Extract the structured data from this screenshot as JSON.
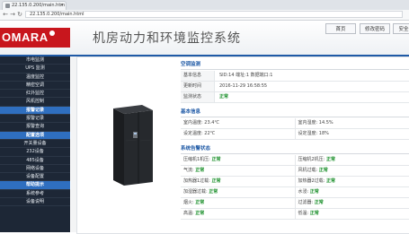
{
  "browser": {
    "tab_title": "22.135.0.200/main.htm",
    "url": "22.135.0.200/main.html"
  },
  "header": {
    "logo_text": "OMARA",
    "title": "机房动力和环境监控系统",
    "buttons": [
      "首页",
      "修改密码",
      "安全"
    ]
  },
  "sidebar": {
    "items": [
      {
        "label": "市电监测",
        "section": false
      },
      {
        "label": "UPS 监测",
        "section": false
      },
      {
        "label": "温度监控",
        "section": false
      },
      {
        "label": "精密空调",
        "section": false
      },
      {
        "label": "红外监控",
        "section": false
      },
      {
        "label": "风机控制",
        "section": false
      },
      {
        "label": "报警记录",
        "section": true
      },
      {
        "label": "报警记录",
        "section": false
      },
      {
        "label": "报警查询",
        "section": false
      },
      {
        "label": "配置选项",
        "section": true
      },
      {
        "label": "开关量设备",
        "section": false
      },
      {
        "label": "232设备",
        "section": false
      },
      {
        "label": "485设备",
        "section": false
      },
      {
        "label": "网络设备",
        "section": false
      },
      {
        "label": "设备配置",
        "section": false
      },
      {
        "label": "帮助提示",
        "section": true
      },
      {
        "label": "系统参考",
        "section": false
      },
      {
        "label": "设备说明",
        "section": false
      }
    ]
  },
  "panel": {
    "monitor_title": "空调监测",
    "monitor_rows": [
      {
        "k": "基本信息",
        "v": "SID:14   端址:1   数据端口:1"
      },
      {
        "k": "更新时间",
        "v": "2016-11-29 16:58:55"
      },
      {
        "k": "监测状态",
        "v": "正常",
        "ok": true
      }
    ],
    "basic_title": "基本信息",
    "basic_rows": [
      [
        "室内温度: 23.4℃",
        "室内湿度: 14.5%"
      ],
      [
        "设定温度: 22℃",
        "设定湿度: 18%"
      ]
    ],
    "alarm_title": "系统告警状态",
    "alarm_rows": [
      [
        {
          "l": "压缩机1机压:",
          "v": "正常"
        },
        {
          "l": "压缩机2机压:",
          "v": "正常"
        }
      ],
      [
        {
          "l": "气流:",
          "v": "正常"
        },
        {
          "l": "风机过载:",
          "v": "正常"
        }
      ],
      [
        {
          "l": "加热器1过载:",
          "v": "正常"
        },
        {
          "l": "加热器2过载:",
          "v": "正常"
        }
      ],
      [
        {
          "l": "加湿器过载:",
          "v": "正常"
        },
        {
          "l": "水浸:",
          "v": "正常"
        }
      ],
      [
        {
          "l": "烟火:",
          "v": "正常"
        },
        {
          "l": "过滤器:",
          "v": "正常"
        }
      ],
      [
        {
          "l": "高温:",
          "v": "正常"
        },
        {
          "l": "低温:",
          "v": "正常"
        }
      ]
    ]
  },
  "colors": {
    "brand_red": "#c8161d",
    "sidebar_bg": "#1d2736",
    "section_blue": "#2f6fc0",
    "ok_green": "#1a8f2a"
  }
}
